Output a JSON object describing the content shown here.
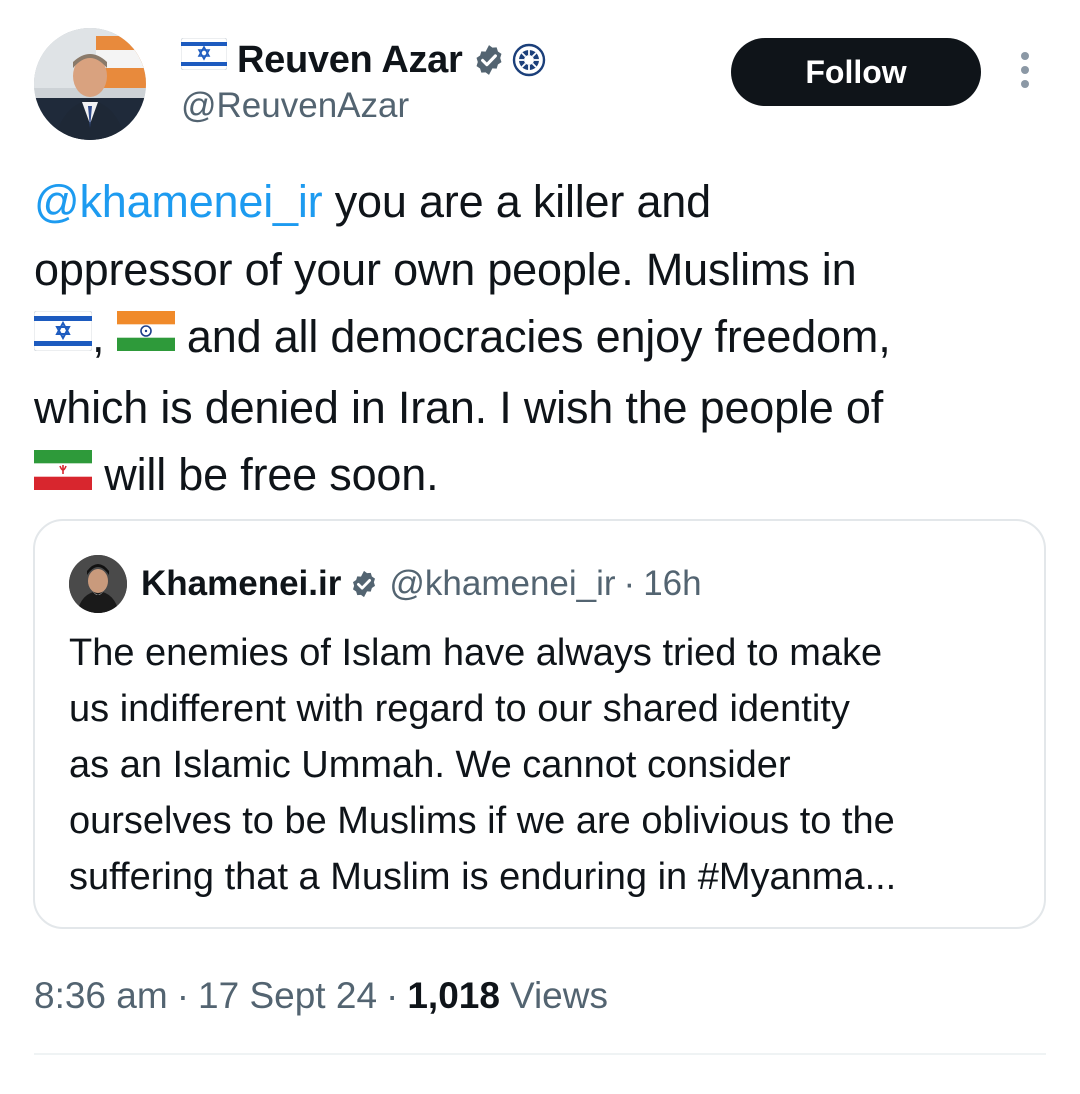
{
  "author": {
    "name": "Reuven Azar",
    "handle": "@ReuvenAzar",
    "verified": true,
    "flag_icon": "israel-flag-icon",
    "affiliation_icon": "government-seal-icon"
  },
  "follow_button": {
    "label": "Follow"
  },
  "more_button": {
    "icon": "more-vertical-icon"
  },
  "tweet": {
    "mention": "@khamenei_ir",
    "line1_rest": " you are a killer and",
    "line2": "oppressor of your own people. Muslims in",
    "line3_comma": ",",
    "line3_rest": " and all democracies enjoy freedom,",
    "line4": "which is denied in Iran. I wish the people of",
    "line5_rest": " will be free soon.",
    "flags": [
      "israel-flag-icon",
      "india-flag-icon",
      "iran-flag-icon"
    ]
  },
  "quote": {
    "name": "Khamenei.ir",
    "verified": true,
    "handle": "@khamenei_ir",
    "separator": "·",
    "time": "16h",
    "lines": [
      "The enemies of Islam have always tried to make",
      "us indifferent with regard to our shared identity",
      "as an Islamic Ummah. We cannot consider",
      "ourselves to be Muslims if we are oblivious to the",
      "suffering that a Muslim is enduring in #Myanma..."
    ]
  },
  "meta": {
    "time": "8:36 am",
    "separator": "·",
    "date": "17 Sept 24",
    "views_count": "1,018",
    "views_label": "Views"
  },
  "colors": {
    "text": "#0f1419",
    "secondary": "#536471",
    "link": "#1d9bf0",
    "follow_bg": "#0f1419",
    "verified_badge": "#536471",
    "card_border": "#e3e7ea"
  }
}
